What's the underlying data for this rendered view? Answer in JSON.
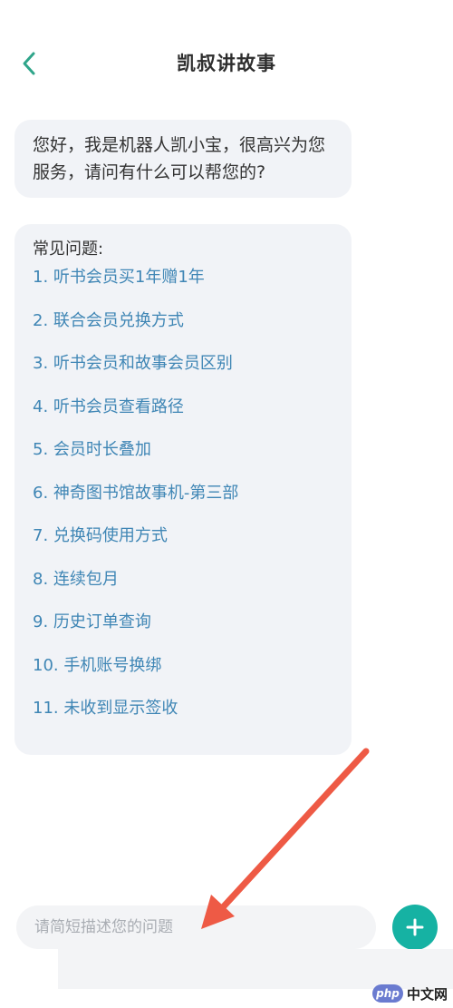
{
  "header": {
    "title": "凯叔讲故事",
    "back_icon": "chevron-left-icon",
    "accent_color": "#2fa58a"
  },
  "messages": {
    "greeting": "您好，我是机器人凯小宝，很高兴为您服务，请问有什么可以帮您的?",
    "faq_heading": "常见问题:",
    "faq_items": [
      "1. 听书会员买1年赠1年",
      "2. 联合会员兑换方式",
      "3. 听书会员和故事会员区别",
      "4. 听书会员查看路径",
      "5. 会员时长叠加",
      "6. 神奇图书馆故事机-第三部",
      "7. 兑换码使用方式",
      "8. 连续包月",
      "9. 历史订单查询",
      "10. 手机账号换绑",
      "11. 未收到显示签收"
    ],
    "link_color": "#3f86b5"
  },
  "composer": {
    "placeholder": "请简短描述您的问题",
    "add_icon": "plus-icon",
    "add_color": "#16b2a3"
  },
  "annotation": {
    "arrow_color": "#ee5a45"
  },
  "watermark": {
    "logo": "php",
    "text": "中文网"
  }
}
